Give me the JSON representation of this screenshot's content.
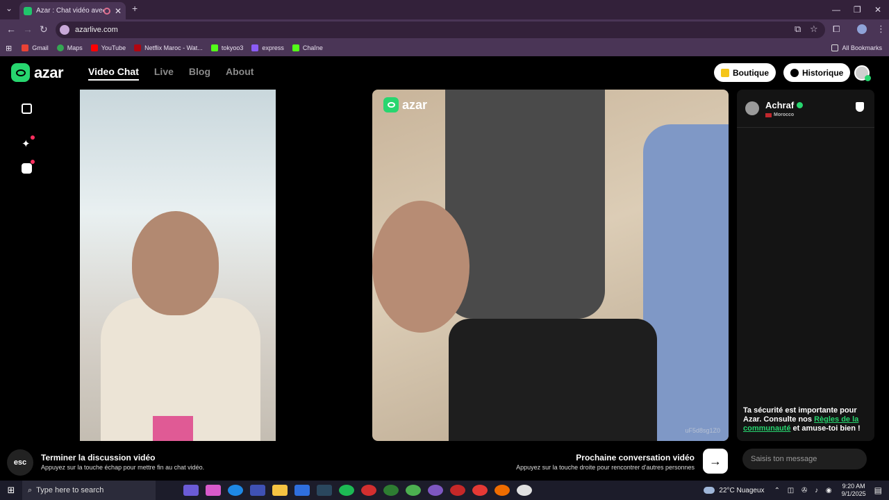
{
  "browser": {
    "tab_title": "Azar : Chat vidéo avec de n",
    "new_tab": "+",
    "url": "azarlive.com",
    "bookmarks": [
      "Gmail",
      "Maps",
      "YouTube",
      "Netflix Maroc - Wat...",
      "tokyoo3",
      "express",
      "Chaîne"
    ],
    "all_bookmarks": "All Bookmarks"
  },
  "site": {
    "logo": "azar",
    "nav": [
      "Video Chat",
      "Live",
      "Blog",
      "About"
    ],
    "boutique": "Boutique",
    "historique": "Historique"
  },
  "peer": {
    "name": "Achraf",
    "country": "Morocco"
  },
  "video": {
    "overlay_logo": "azar",
    "watermark": "uF5d8sg1Z0"
  },
  "safety": {
    "text1": "Ta sécurité est importante pour Azar. Consulte nos ",
    "link": "Règles de la communauté",
    "text2": " et amuse-toi bien !"
  },
  "controls": {
    "esc": "esc",
    "end_title": "Terminer la discussion vidéo",
    "end_sub": "Appuyez sur la touche échap pour mettre fin au chat vidéo.",
    "next_title": "Prochaine conversation vidéo",
    "next_sub": "Appuyez sur la touche droite pour rencontrer d'autres personnes",
    "message_placeholder": "Saisis ton message"
  },
  "taskbar": {
    "search": "Type here to search",
    "weather": "22°C  Nuageux",
    "time": "9:20 AM",
    "date": "9/1/2025"
  },
  "colors": {
    "accent": "#27d66f",
    "chrome": "#4a3556"
  }
}
